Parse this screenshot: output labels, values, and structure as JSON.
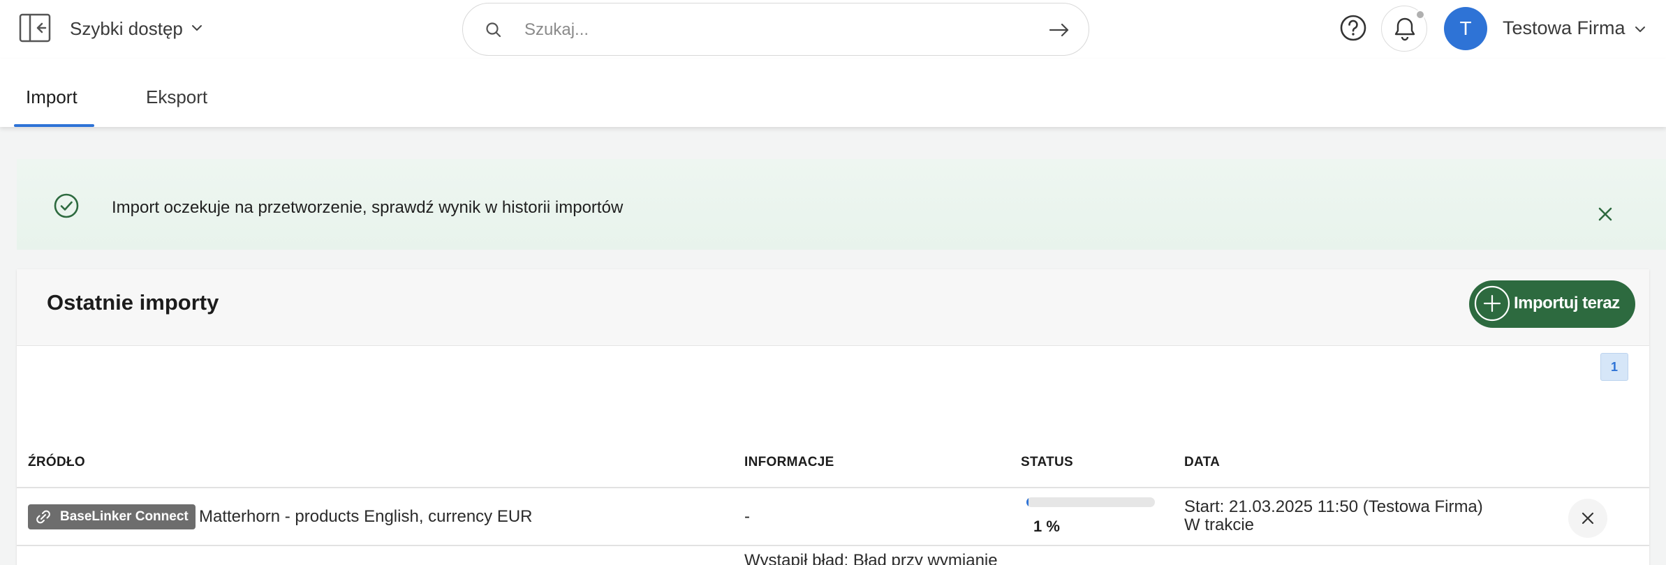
{
  "header": {
    "quick_access": "Szybki dostęp",
    "search_placeholder": "Szukaj...",
    "avatar_letter": "T",
    "company": "Testowa Firma"
  },
  "tabs": [
    {
      "label": "Import",
      "active": true
    },
    {
      "label": "Eksport",
      "active": false
    }
  ],
  "alert": {
    "text": "Import oczekuje na przetworzenie, sprawdź wynik w historii importów"
  },
  "imports": {
    "title": "Ostatnie importy",
    "import_button": "Importuj teraz",
    "page": "1",
    "columns": [
      "ŹRÓDŁO",
      "INFORMACJE",
      "STATUS",
      "DATA"
    ],
    "rows": [
      {
        "source_badge": "BaseLinker Connect",
        "name": "Matterhorn - products English, currency EUR",
        "info": "-",
        "progress": 1,
        "progress_label": "1 %",
        "date_start": "Start: 21.03.2025 11:50 (Testowa Firma)",
        "date_status": "W trakcie"
      },
      {
        "info": "Wystąpił błąd: Błąd przy wymianie"
      }
    ]
  },
  "colors": {
    "primary": "#2e73d6",
    "success_green": "#2d6a3f",
    "alert_bg": "#eef6f1"
  }
}
